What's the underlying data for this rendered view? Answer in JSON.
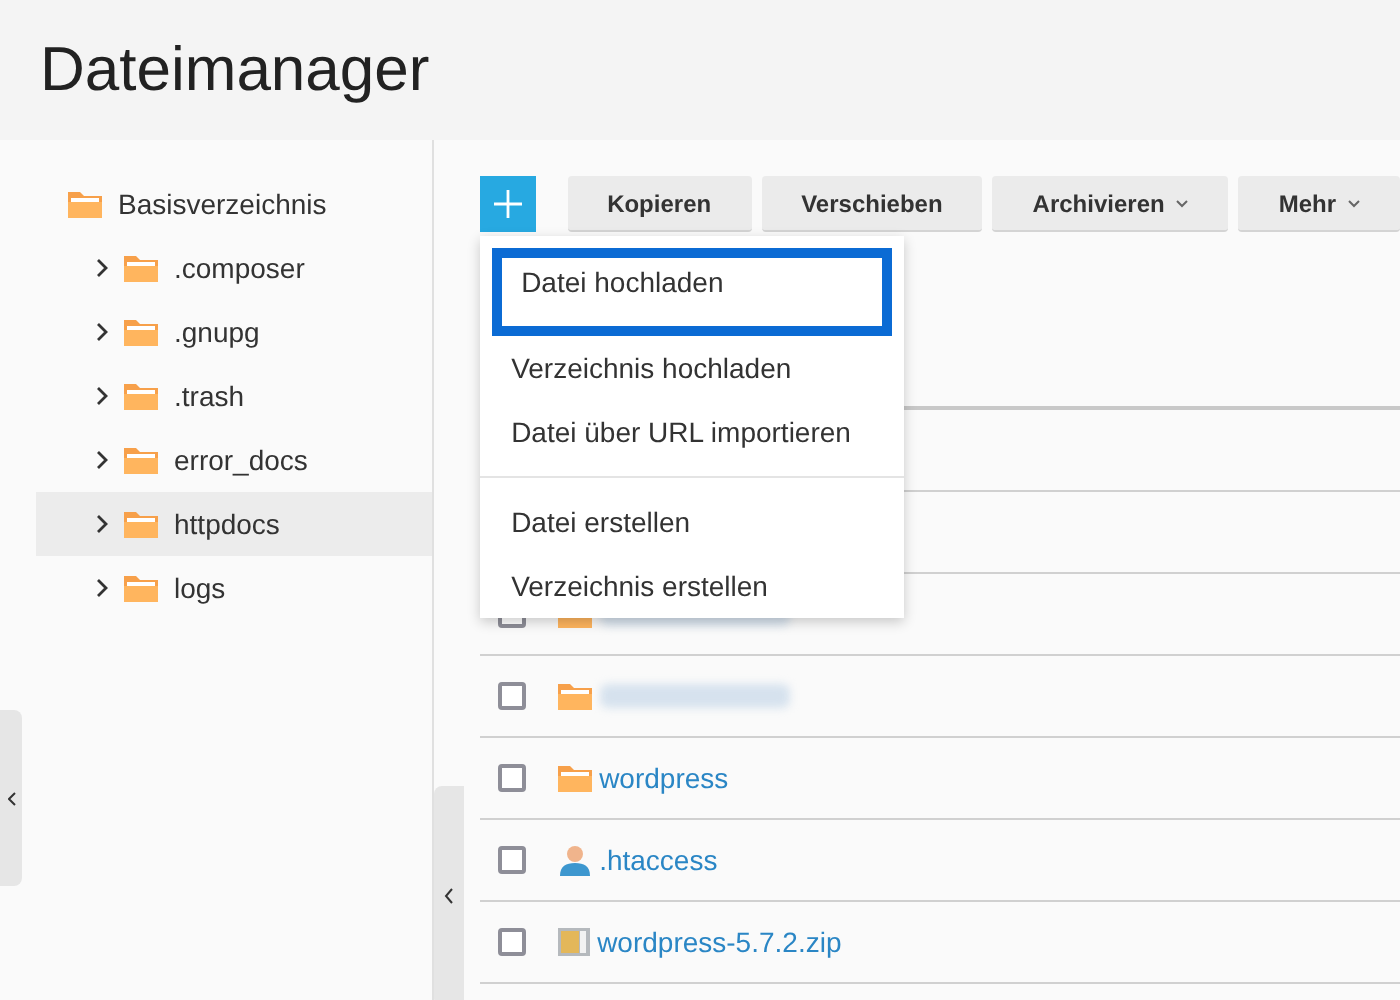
{
  "title": "Dateimanager",
  "tree": {
    "root": "Basisverzeichnis",
    "children": [
      {
        "label": ".composer",
        "selected": false
      },
      {
        "label": ".gnupg",
        "selected": false
      },
      {
        "label": ".trash",
        "selected": false
      },
      {
        "label": "error_docs",
        "selected": false
      },
      {
        "label": "httpdocs",
        "selected": true
      },
      {
        "label": "logs",
        "selected": false
      }
    ]
  },
  "toolbar": {
    "buttons": [
      {
        "label": "Kopieren",
        "dropdown": false
      },
      {
        "label": "Verschieben",
        "dropdown": false
      },
      {
        "label": "Archivieren",
        "dropdown": true
      },
      {
        "label": "Mehr",
        "dropdown": true
      }
    ]
  },
  "menu": {
    "items": [
      {
        "label": "Datei hochladen",
        "selected": true,
        "divider_after": false
      },
      {
        "label": "Verzeichnis hochladen",
        "selected": false,
        "divider_after": false
      },
      {
        "label": "Datei über URL importieren",
        "selected": false,
        "divider_after": true
      },
      {
        "label": "Datei erstellen",
        "selected": false,
        "divider_after": false
      },
      {
        "label": "Verzeichnis erstellen",
        "selected": false,
        "divider_after": false
      }
    ]
  },
  "rows": [
    {
      "kind": "hidden"
    },
    {
      "kind": "hidden"
    },
    {
      "kind": "blurred-folder",
      "checked": false
    },
    {
      "kind": "blurred-folder",
      "checked": false
    },
    {
      "kind": "folder",
      "name": "wordpress",
      "checked": false
    },
    {
      "kind": "user",
      "name": ".htaccess",
      "checked": false
    },
    {
      "kind": "archive",
      "name": "wordpress-5.7.2.zip",
      "checked": false
    }
  ]
}
